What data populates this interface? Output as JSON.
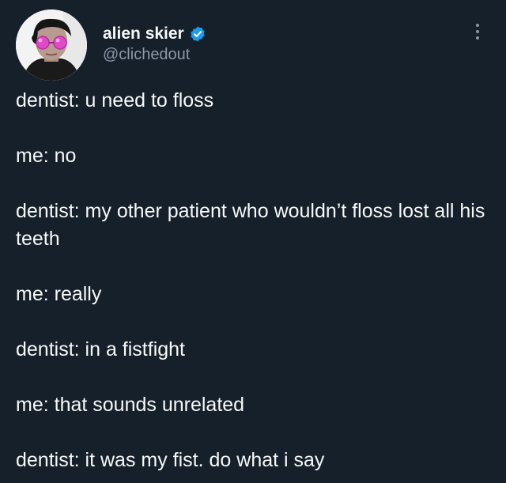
{
  "author": {
    "display_name": "alien skier",
    "handle": "@clichedout",
    "verified": true,
    "verified_color": "#1d9bf0",
    "avatar_icon": "profile-photo-person-with-pink-glasses"
  },
  "menu": {
    "icon": "more-options-icon"
  },
  "tweet": {
    "lines": [
      "dentist: u need to floss",
      "me: no",
      "dentist: my other patient who wouldn’t floss lost all his teeth",
      "me: really",
      "dentist: in a fistfight",
      "me: that sounds unrelated",
      "dentist: it was my fist. do what i say"
    ]
  },
  "colors": {
    "background": "#15202b",
    "text": "#f7f9f9",
    "secondary_text": "#8b98a5"
  }
}
